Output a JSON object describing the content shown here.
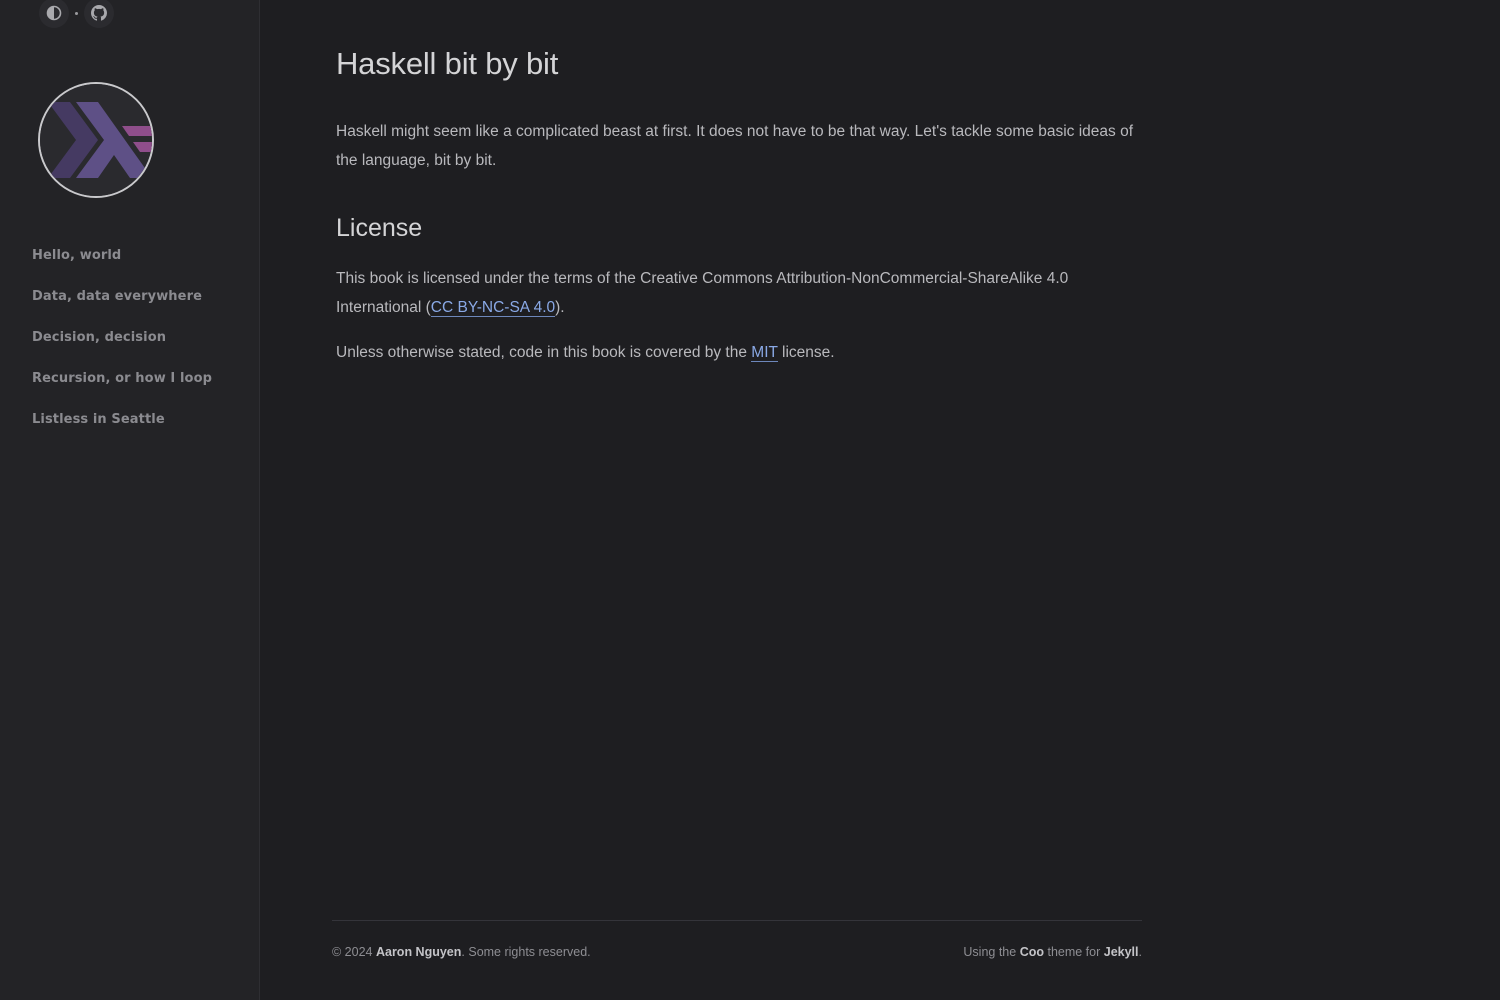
{
  "topbar": {
    "theme_icon": "contrast-icon",
    "github_icon": "github-icon"
  },
  "sidebar": {
    "avatar_icon": "haskell-logo",
    "nav_items": [
      {
        "label": "Hello, world"
      },
      {
        "label": "Data, data everywhere"
      },
      {
        "label": "Decision, decision"
      },
      {
        "label": "Recursion, or how I loop"
      },
      {
        "label": "Listless in Seattle"
      }
    ]
  },
  "main": {
    "title": "Haskell bit by bit",
    "intro": "Haskell might seem like a complicated beast at first. It does not have to be that way. Let's tackle some basic ideas of the language, bit by bit.",
    "license_heading": "License",
    "license_text_before": "This book is licensed under the terms of the Creative Commons Attribution-NonCommercial-ShareAlike 4.0 International (",
    "license_link": "CC BY-NC-SA 4.0",
    "license_text_after": ").",
    "code_text_before": "Unless otherwise stated, code in this book is covered by the ",
    "code_link": "MIT",
    "code_text_after": " license."
  },
  "footer": {
    "copyright_prefix": "© 2024 ",
    "author": "Aaron Nguyen",
    "rights": ". Some rights reserved.",
    "using_prefix": "Using the ",
    "theme_name": "Coo",
    "theme_mid": " theme for ",
    "engine": "Jekyll",
    "end": "."
  },
  "colors": {
    "background": "#1e1e21",
    "sidebar": "#232326",
    "link": "#8aa9e6",
    "logo_dark": "#453a62",
    "logo_mid": "#5e5086",
    "logo_light": "#8f4e8b"
  }
}
